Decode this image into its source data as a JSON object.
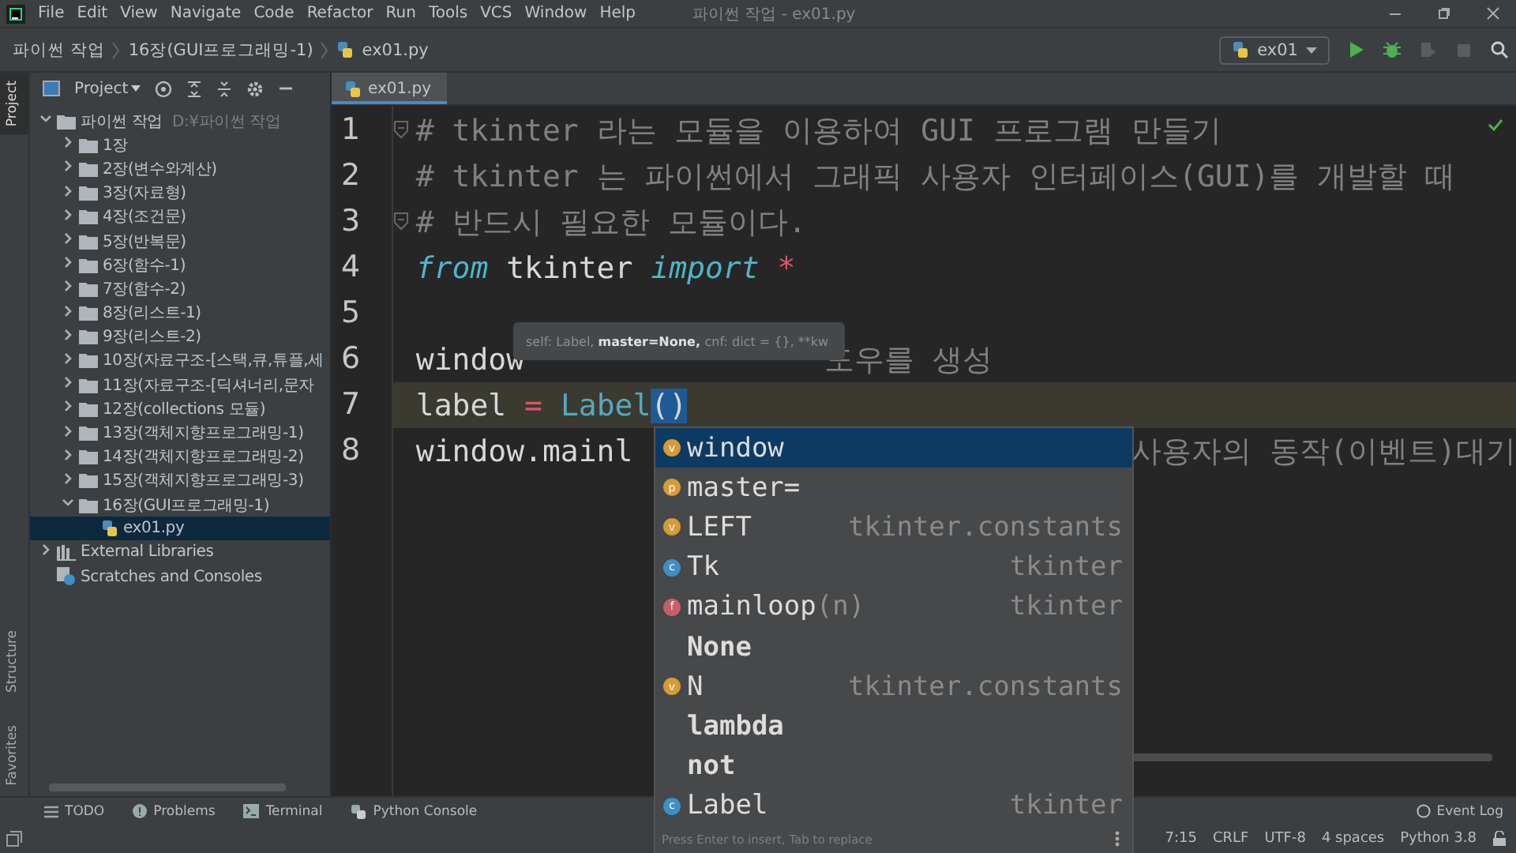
{
  "window": {
    "title": "파이썬 작업 - ex01.py"
  },
  "menu": [
    "File",
    "Edit",
    "View",
    "Navigate",
    "Code",
    "Refactor",
    "Run",
    "Tools",
    "VCS",
    "Window",
    "Help"
  ],
  "breadcrumb": [
    {
      "label": "파이썬 작업",
      "kind": "folder"
    },
    {
      "label": "16장(GUI프로그래밍-1)",
      "kind": "folder"
    },
    {
      "label": "ex01.py",
      "kind": "file"
    }
  ],
  "run_config": {
    "label": "ex01"
  },
  "side_strip_top": [
    {
      "label": "Project",
      "selected": true
    }
  ],
  "side_strip_bottom": [
    {
      "label": "Structure",
      "selected": false
    },
    {
      "label": "Favorites",
      "selected": false
    }
  ],
  "project_panel": {
    "title": "Project"
  },
  "project_tree": [
    {
      "label": "파이썬 작업",
      "path": "D:¥파이썬 작업",
      "kind": "folder",
      "expanded": true,
      "selected": false,
      "children": [
        {
          "label": "1장",
          "kind": "folder",
          "expanded": false,
          "selected": false
        },
        {
          "label": "2장(변수와계산)",
          "kind": "folder",
          "expanded": false,
          "selected": false
        },
        {
          "label": "3장(자료형)",
          "kind": "folder",
          "expanded": false,
          "selected": false
        },
        {
          "label": "4장(조건문)",
          "kind": "folder",
          "expanded": false,
          "selected": false
        },
        {
          "label": "5장(반복문)",
          "kind": "folder",
          "expanded": false,
          "selected": false
        },
        {
          "label": "6장(함수-1)",
          "kind": "folder",
          "expanded": false,
          "selected": false
        },
        {
          "label": "7장(함수-2)",
          "kind": "folder",
          "expanded": false,
          "selected": false
        },
        {
          "label": "8장(리스트-1)",
          "kind": "folder",
          "expanded": false,
          "selected": false
        },
        {
          "label": "9장(리스트-2)",
          "kind": "folder",
          "expanded": false,
          "selected": false
        },
        {
          "label": "10장(자료구조-[스택,큐,튜플,세",
          "kind": "folder",
          "expanded": false,
          "selected": false
        },
        {
          "label": "11장(자료구조-[딕셔너리,문자",
          "kind": "folder",
          "expanded": false,
          "selected": false
        },
        {
          "label": "12장(collections 모듈)",
          "kind": "folder",
          "expanded": false,
          "selected": false
        },
        {
          "label": "13장(객체지향프로그래밍-1)",
          "kind": "folder",
          "expanded": false,
          "selected": false
        },
        {
          "label": "14장(객체지향프로그래밍-2)",
          "kind": "folder",
          "expanded": false,
          "selected": false
        },
        {
          "label": "15장(객체지향프로그래밍-3)",
          "kind": "folder",
          "expanded": false,
          "selected": false
        },
        {
          "label": "16장(GUI프로그래밍-1)",
          "kind": "folder",
          "expanded": true,
          "selected": false,
          "children": [
            {
              "label": "ex01.py",
              "kind": "file",
              "selected": true
            }
          ]
        }
      ]
    },
    {
      "label": "External Libraries",
      "kind": "libraries",
      "expanded": false,
      "selected": false
    },
    {
      "label": "Scratches and Consoles",
      "kind": "scratches",
      "selected": false
    }
  ],
  "editor_tab": {
    "label": "ex01.py",
    "selected": true
  },
  "code_lines": [
    {
      "number": "1",
      "current": false,
      "tokens": [
        {
          "text": "# tkinter 라는 모듈을 이용하여 GUI 프로그램 만들기",
          "kind": "comment"
        }
      ]
    },
    {
      "number": "2",
      "current": false,
      "tokens": [
        {
          "text": "# tkinter 는 파이썬에서 그래픽 사용자 인터페이스(GUI)를 개발할 때",
          "kind": "comment"
        }
      ]
    },
    {
      "number": "3",
      "current": false,
      "tokens": [
        {
          "text": "# 반드시 필요한 모듈이다.",
          "kind": "comment"
        }
      ]
    },
    {
      "number": "4",
      "current": false,
      "tokens": [
        {
          "text": "from",
          "kind": "keyword"
        },
        {
          "text": "tkinter",
          "kind": "plain"
        },
        {
          "text": "import",
          "kind": "keyword"
        },
        {
          "text": "*",
          "kind": "operator"
        }
      ]
    },
    {
      "number": "5",
      "current": false
    },
    {
      "number": "6",
      "current": false,
      "tokens": [
        {
          "text": "window",
          "kind": "plain"
        },
        {
          "text": "도우를 생성",
          "kind": "trailing-comment"
        }
      ]
    },
    {
      "number": "7",
      "current": true,
      "tokens": [
        {
          "text": "label",
          "kind": "plain"
        },
        {
          "text": "=",
          "kind": "operator"
        },
        {
          "text": "Label",
          "kind": "call"
        },
        {
          "text": "()",
          "kind": "bracket-match"
        }
      ]
    },
    {
      "number": "8",
      "current": false,
      "tokens": [
        {
          "text": "window.mainl",
          "kind": "plain"
        },
        {
          "text": "사용자의 동작(이벤트)대기",
          "kind": "trailing-comment"
        }
      ]
    }
  ],
  "parameter_hint": [
    {
      "text": "self: Label,",
      "bold": false
    },
    {
      "text": "master=None,",
      "bold": true
    },
    {
      "text": "cnf: dict = {}, **kw",
      "bold": false
    }
  ],
  "completion": {
    "items": [
      {
        "name": "window",
        "badge": "v",
        "color": "#d69a36",
        "selected": true,
        "kind": "symbol"
      },
      {
        "name": "master=",
        "badge": "p",
        "color": "#d69a36",
        "selected": false,
        "kind": "symbol"
      },
      {
        "name": "LEFT",
        "badge": "v",
        "color": "#d69a36",
        "source": "tkinter.constants",
        "selected": false,
        "kind": "symbol"
      },
      {
        "name": "Tk",
        "badge": "c",
        "color": "#3d8fc4",
        "source": "tkinter",
        "selected": false,
        "kind": "symbol"
      },
      {
        "name": "mainloop",
        "params": "(n)",
        "badge": "f",
        "color": "#c75f6b",
        "source": "tkinter",
        "selected": false,
        "kind": "symbol"
      },
      {
        "name": "None",
        "selected": false,
        "kind": "keyword"
      },
      {
        "name": "N",
        "badge": "v",
        "color": "#d69a36",
        "source": "tkinter.constants",
        "selected": false,
        "kind": "symbol"
      },
      {
        "name": "lambda",
        "selected": false,
        "kind": "keyword"
      },
      {
        "name": "not",
        "selected": false,
        "kind": "keyword"
      },
      {
        "name": "Label",
        "badge": "c",
        "color": "#3d8fc4",
        "source": "tkinter",
        "selected": false,
        "kind": "symbol"
      }
    ],
    "hint": "Press Enter to insert, Tab to replace"
  },
  "tool_tabs": [
    {
      "label": "TODO",
      "kind": "list"
    },
    {
      "label": "Problems",
      "kind": "info"
    },
    {
      "label": "Terminal",
      "kind": "terminal"
    },
    {
      "label": "Python Console",
      "kind": "python"
    }
  ],
  "event_log": "Event Log",
  "status_bar": [
    "7:15",
    "CRLF",
    "UTF-8",
    "4 spaces",
    "Python 3.8"
  ]
}
